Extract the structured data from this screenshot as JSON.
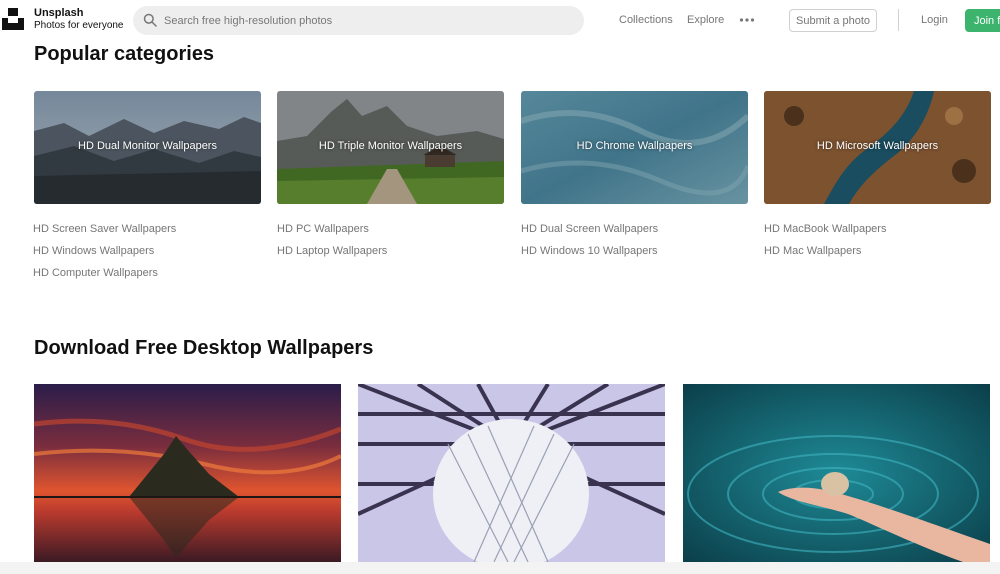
{
  "header": {
    "brand_name": "Unsplash",
    "brand_tagline": "Photos for everyone",
    "search_placeholder": "Search free high-resolution photos",
    "nav": [
      {
        "label": "Collections"
      },
      {
        "label": "Explore"
      }
    ],
    "more_icon": "more-dots-icon",
    "submit_label": "Submit a photo",
    "login_label": "Login",
    "join_label": "Join f",
    "accent_color": "#3cb46e"
  },
  "popular": {
    "title": "Popular categories",
    "cards": [
      {
        "label": "HD Dual Monitor Wallpapers"
      },
      {
        "label": "HD Triple Monitor Wallpapers"
      },
      {
        "label": "HD Chrome Wallpapers"
      },
      {
        "label": "HD Microsoft Wallpapers"
      }
    ],
    "columns": [
      [
        "HD Screen Saver Wallpapers",
        "HD Windows Wallpapers",
        "HD Computer Wallpapers"
      ],
      [
        "HD PC Wallpapers",
        "HD Laptop Wallpapers"
      ],
      [
        "HD Dual Screen Wallpapers",
        "HD Windows 10 Wallpapers"
      ],
      [
        "HD MacBook Wallpapers",
        "HD Mac Wallpapers"
      ]
    ]
  },
  "download": {
    "title": "Download Free Desktop Wallpapers"
  }
}
